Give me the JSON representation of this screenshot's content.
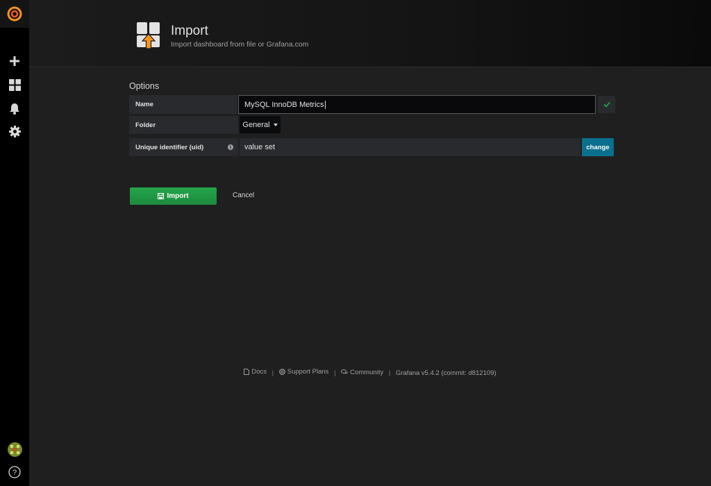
{
  "header": {
    "title": "Import",
    "subtitle": "Import dashboard from file or Grafana.com"
  },
  "sidebar": {
    "items": [
      {
        "icon": "grafana-logo-icon"
      },
      {
        "icon": "plus-icon"
      },
      {
        "icon": "dashboards-icon"
      },
      {
        "icon": "bell-icon"
      },
      {
        "icon": "gear-icon"
      },
      {
        "icon": "avatar"
      },
      {
        "icon": "help-icon",
        "label": "?"
      }
    ]
  },
  "options": {
    "section_title": "Options",
    "name_label": "Name",
    "name_value": "MySQL InnoDB Metrics",
    "folder_label": "Folder",
    "folder_value": "General",
    "uid_label": "Unique identifier (uid)",
    "uid_value": "value set",
    "change_label": "change"
  },
  "actions": {
    "import_label": "Import",
    "cancel_label": "Cancel"
  },
  "footer": {
    "docs": "Docs",
    "support": "Support Plans",
    "community": "Community",
    "version": "Grafana v5.4.2 (commit: d812109)",
    "separator": "|"
  },
  "colors": {
    "accent_orange": "#f7941e",
    "success_green": "#1d9b45",
    "change_blue": "#0b6f8e"
  }
}
